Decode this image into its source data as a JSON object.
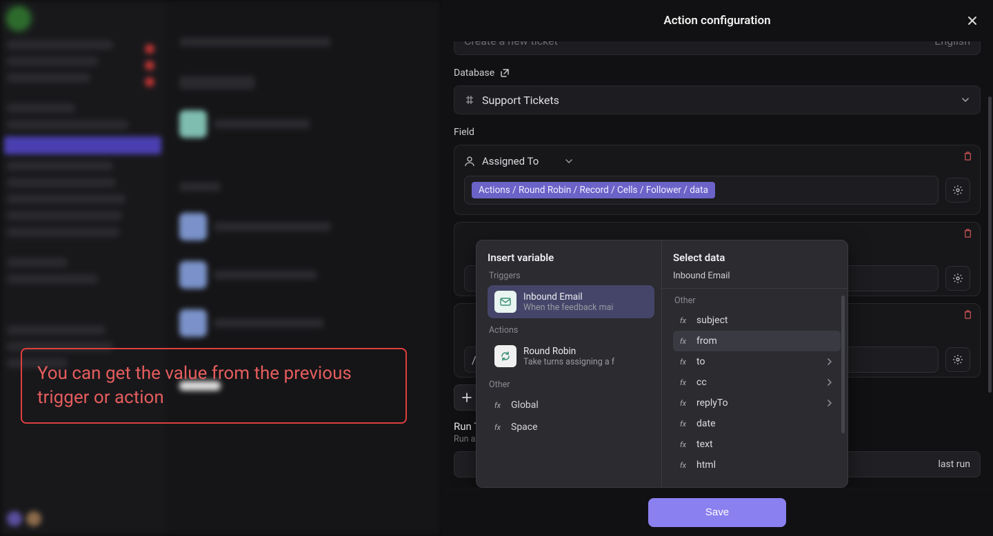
{
  "callout": "You can get the value from the previous trigger or action",
  "panel": {
    "title": "Action configuration",
    "top_dropdown": {
      "value": "Create a new ticket",
      "lang": "English"
    },
    "database": {
      "label": "Database",
      "value": "Support Tickets"
    },
    "field_label": "Field",
    "fields": [
      {
        "name": "Assigned To",
        "value_token": "Actions / Round Robin / Record / Cells / Follower / data"
      }
    ],
    "extra_field_cards": 2,
    "slash_value": "/",
    "run": {
      "title_prefix": "Run T",
      "sub_prefix": "Run a t",
      "last_run": "last run"
    },
    "save": "Save"
  },
  "popover": {
    "left_title": "Insert variable",
    "right_title": "Select data",
    "right_sub": "Inbound Email",
    "sections": {
      "triggers": "Triggers",
      "actions": "Actions",
      "other": "Other"
    },
    "triggers": [
      {
        "name": "Inbound Email",
        "desc": "When the feedback mai",
        "active": true
      }
    ],
    "actions": [
      {
        "name": "Round Robin",
        "desc": "Take turns assigning a f"
      }
    ],
    "other": [
      {
        "name": "Global"
      },
      {
        "name": "Space"
      }
    ],
    "right_section": "Other",
    "data_items": [
      {
        "name": "subject",
        "has_sub": false
      },
      {
        "name": "from",
        "has_sub": false,
        "hover": true
      },
      {
        "name": "to",
        "has_sub": true
      },
      {
        "name": "cc",
        "has_sub": true
      },
      {
        "name": "replyTo",
        "has_sub": true
      },
      {
        "name": "date",
        "has_sub": false
      },
      {
        "name": "text",
        "has_sub": false
      },
      {
        "name": "html",
        "has_sub": false
      }
    ]
  }
}
